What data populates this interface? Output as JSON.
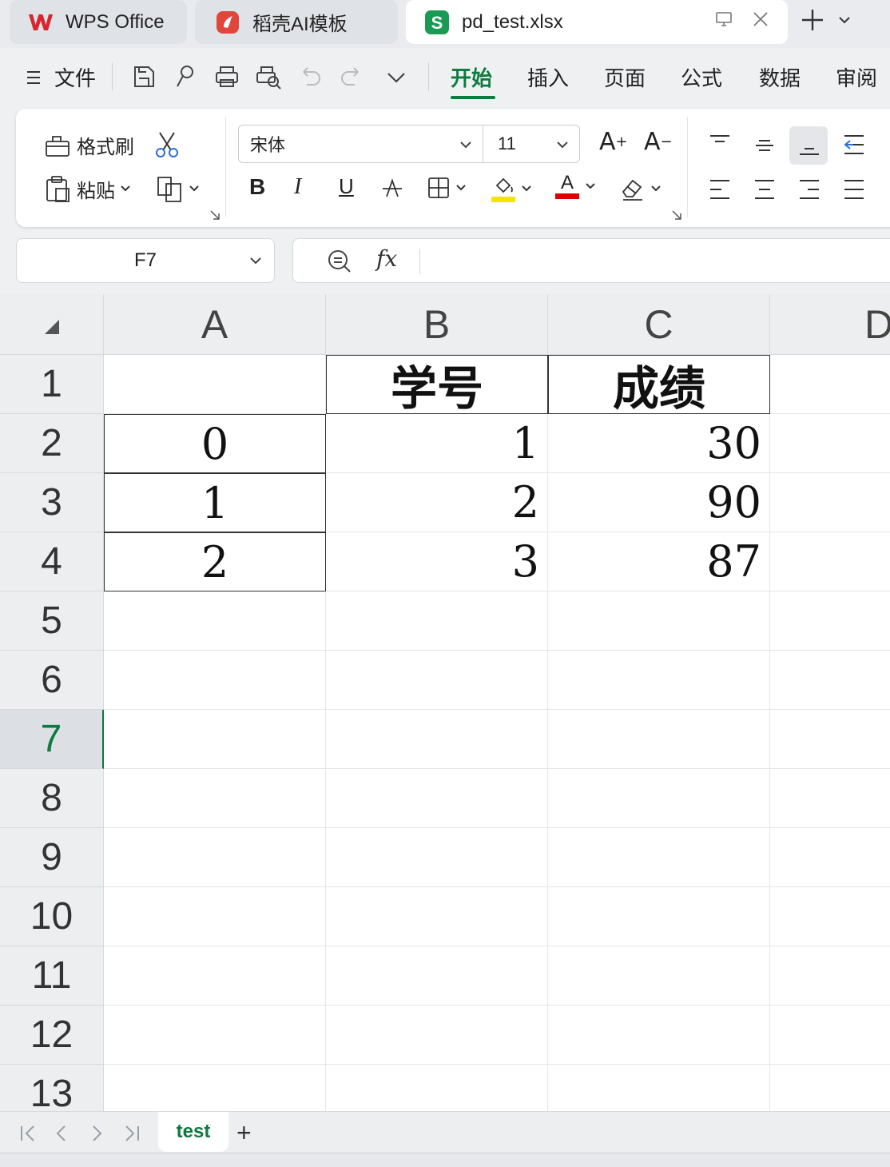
{
  "tabs": {
    "wps": "WPS Office",
    "ai": "稻壳AI模板",
    "file": "pd_test.xlsx"
  },
  "menu": {
    "file": "文件",
    "tabs": [
      "开始",
      "插入",
      "页面",
      "公式",
      "数据",
      "审阅"
    ],
    "active": "开始"
  },
  "ribbon": {
    "format_painter": "格式刷",
    "paste": "粘贴",
    "font_name": "宋体",
    "font_size": "11",
    "bold": "B",
    "italic": "I",
    "underline": "U",
    "grow_font": "A",
    "shrink_font": "A",
    "font_color_letter": "A"
  },
  "colors": {
    "accent": "#0d7a3e",
    "fill_color": "#f5e400",
    "font_color": "#e00000",
    "sheets_icon_bg": "#1a9a53",
    "wps_red": "#d8262f"
  },
  "formula": {
    "name_box": "F7",
    "fx": "fx",
    "value": ""
  },
  "sheet": {
    "columns": [
      "A",
      "B",
      "C",
      "D"
    ],
    "rows": [
      "1",
      "2",
      "3",
      "4",
      "5",
      "6",
      "7",
      "8",
      "9",
      "10",
      "11",
      "12",
      "13"
    ],
    "selected_row": "7",
    "selected_cell": "F7",
    "cells": {
      "B1": "学号",
      "C1": "成绩",
      "A2": "0",
      "B2": "1",
      "C2": "30",
      "A3": "1",
      "B3": "2",
      "C3": "90",
      "A4": "2",
      "B4": "3",
      "C4": "87"
    }
  },
  "sheet_tabs": {
    "active": "test",
    "add": "+"
  }
}
